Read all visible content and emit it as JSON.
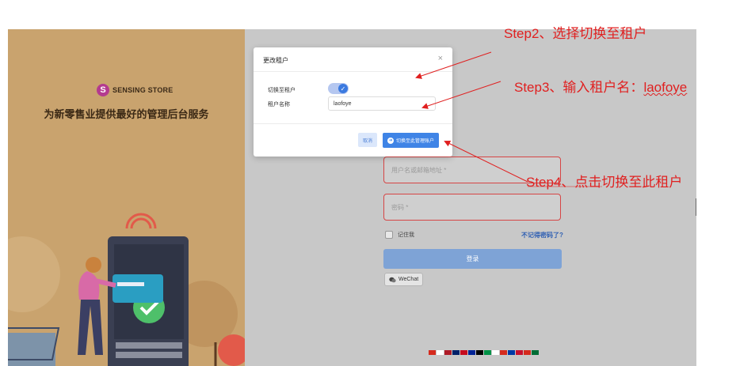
{
  "brand": {
    "name": "SENSING STORE",
    "logo_letter": "S"
  },
  "tagline": "为新零售业提供最好的管理后台服务",
  "login": {
    "username_placeholder": "用户名或邮箱地址 *",
    "password_placeholder": "密码 *",
    "remember_label": "记住我",
    "forgot_label": "不记得密码了?",
    "login_button": "登录",
    "wechat_button": "WeChat"
  },
  "modal": {
    "title": "更改租户",
    "close_glyph": "×",
    "switch_label": "切换至租户",
    "switch_on": true,
    "tenant_label": "租户名称",
    "tenant_value": "laofoye",
    "cancel_button": "取消",
    "switch_button": "切换至此管理账户"
  },
  "annotations": {
    "step2": "Step2、选择切换至租户",
    "step3_prefix": "Step3、输入租户名：",
    "step3_name": "laofoye",
    "step4": "Step4、点击切换至此租户"
  },
  "colors": {
    "left_bg": "#c9a36e",
    "overlay_bg": "#c8c8c8",
    "primary": "#3f84e6",
    "annotation": "#e02020",
    "error_border": "#d64545"
  },
  "flags": [
    "#d52b1e",
    "#ffffff",
    "#ae1c28",
    "#012169",
    "#c60b1e",
    "#002395",
    "#000000",
    "#009246",
    "#ffffff",
    "#d52b1e",
    "#0039a6",
    "#c8102e",
    "#d52b1e",
    "#006c35"
  ]
}
